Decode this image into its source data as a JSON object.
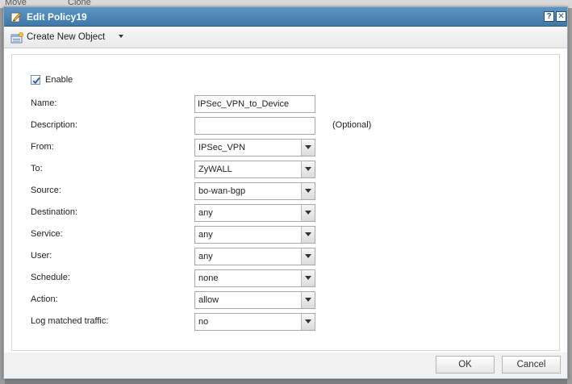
{
  "background": {
    "move_label": "Move",
    "clone_label": "Clone"
  },
  "dialog": {
    "title": "Edit Policy19",
    "help_symbol": "?",
    "close_symbol": "✕"
  },
  "toolbar": {
    "create_label": "Create New Object"
  },
  "form": {
    "enable_label": "Enable",
    "enable_checked": true,
    "fields": [
      {
        "label": "Name:",
        "value": "IPSec_VPN_to_Device",
        "type": "text"
      },
      {
        "label": "Description:",
        "value": "",
        "type": "text",
        "hint": "(Optional)"
      },
      {
        "label": "From:",
        "value": "IPSec_VPN",
        "type": "select"
      },
      {
        "label": "To:",
        "value": "ZyWALL",
        "type": "select"
      },
      {
        "label": "Source:",
        "value": "bo-wan-bgp",
        "type": "select"
      },
      {
        "label": "Destination:",
        "value": "any",
        "type": "select"
      },
      {
        "label": "Service:",
        "value": "any",
        "type": "select"
      },
      {
        "label": "User:",
        "value": "any",
        "type": "select"
      },
      {
        "label": "Schedule:",
        "value": "none",
        "type": "select"
      },
      {
        "label": "Action:",
        "value": "allow",
        "type": "select"
      },
      {
        "label": "Log matched traffic:",
        "value": "no",
        "type": "select"
      }
    ]
  },
  "footer": {
    "ok_label": "OK",
    "cancel_label": "Cancel"
  },
  "colors": {
    "titlebar": "#4a86b8",
    "checkbox_check": "#2a5a9a"
  },
  "icons": {
    "title": "edit-pencil-icon",
    "create": "new-object-icon",
    "dropdown": "chevron-down-icon"
  }
}
